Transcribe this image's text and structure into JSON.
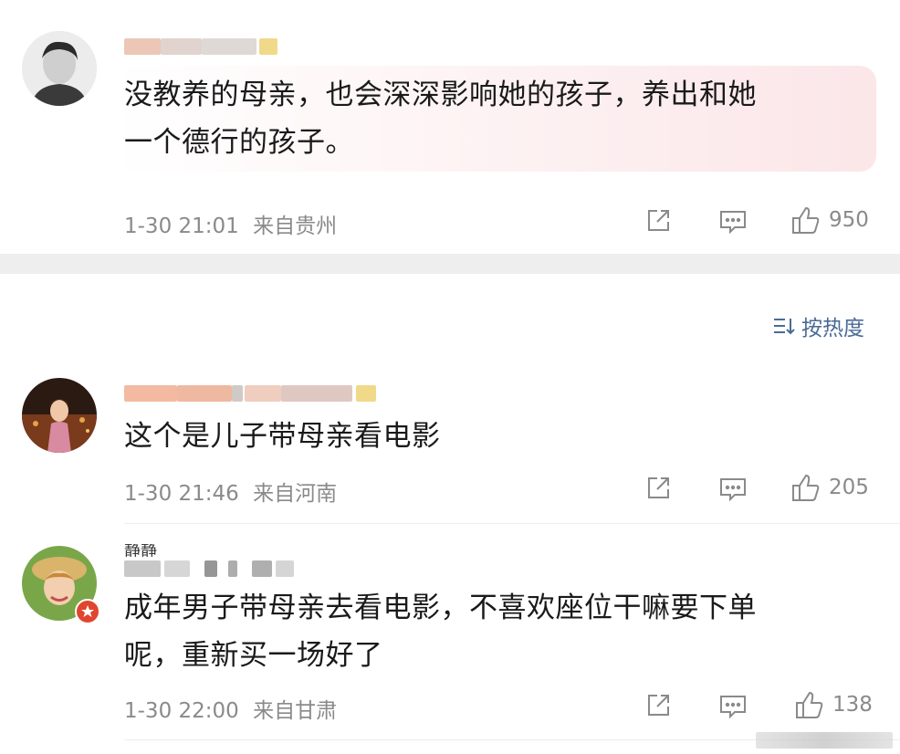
{
  "top_comment": {
    "text": "没教养的母亲，也会深深影响她的孩子，养出和她一个德行的孩子。",
    "line1": "没教养的母亲，也会深深影响她的孩子，养出和她",
    "line2": "一个德行的孩子。",
    "time": "1-30 21:01",
    "location": "来自贵州",
    "likes": "950"
  },
  "sort": {
    "label": "按热度",
    "icon": "sort-icon"
  },
  "comments": [
    {
      "text": "这个是儿子带母亲看电影",
      "time": "1-30 21:46",
      "location": "来自河南",
      "likes": "205"
    },
    {
      "username_visible": "静静",
      "line1": "成年男子带母亲去看电影，不喜欢座位干嘛要下单",
      "line2": "呢，重新买一场好了",
      "time": "1-30 22:00",
      "location": "来自甘肃",
      "likes": "138"
    }
  ],
  "icons": {
    "share": "share-icon",
    "comment": "comment-icon",
    "like": "thumbs-up-icon",
    "badge": "star-badge-icon"
  },
  "colors": {
    "meta": "#8a8a8a",
    "link": "#4a6b96",
    "badge": "#e0452f"
  }
}
